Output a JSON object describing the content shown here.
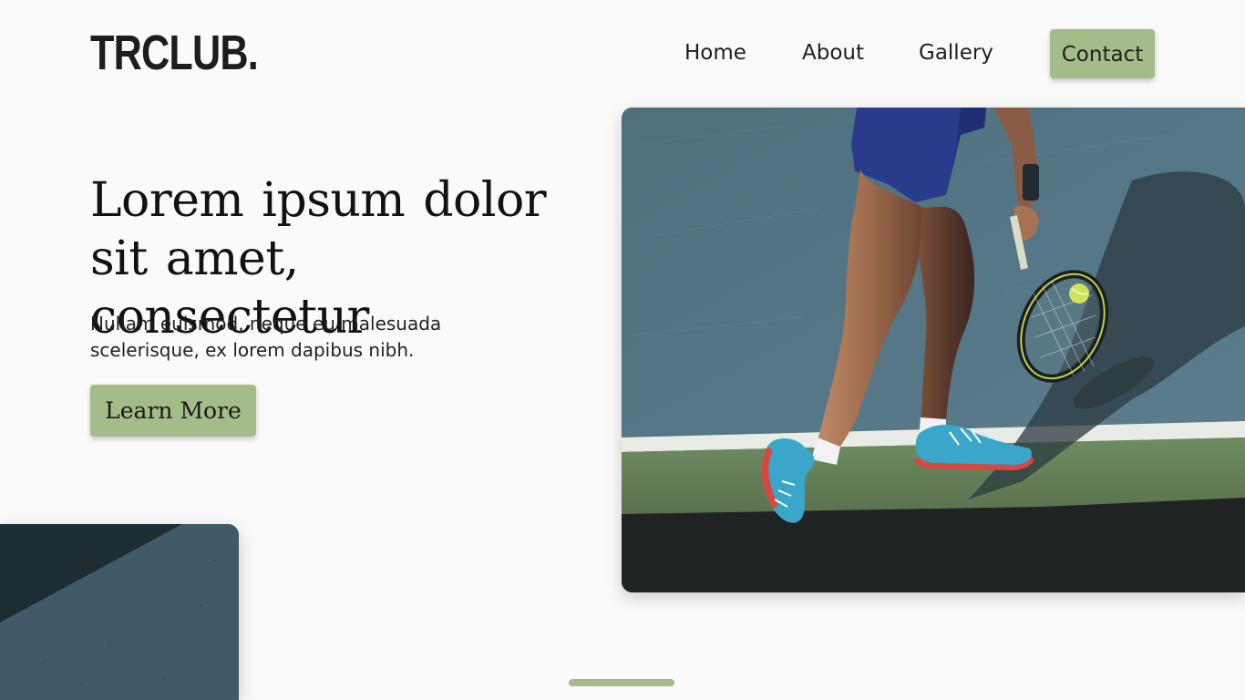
{
  "brand": {
    "logo_text": "TRCLUB.",
    "accent_color": "#a3bc88"
  },
  "nav": {
    "items": [
      {
        "label": "Home"
      },
      {
        "label": "About"
      },
      {
        "label": "Gallery"
      },
      {
        "label": "Contact",
        "style": "button"
      }
    ]
  },
  "hero": {
    "title": "Lorem ipsum dolor sit amet, consectetur",
    "subtitle": "Nullam euismod, neque eu malesuada scelerisque, ex lorem dapibus nibh.",
    "cta_label": "Learn More"
  },
  "media": {
    "hero_image_icon": "tennis-player-photo",
    "side_image_icon": "court-surface-photo"
  },
  "slider": {
    "indicator_icon": "slide-indicator"
  }
}
